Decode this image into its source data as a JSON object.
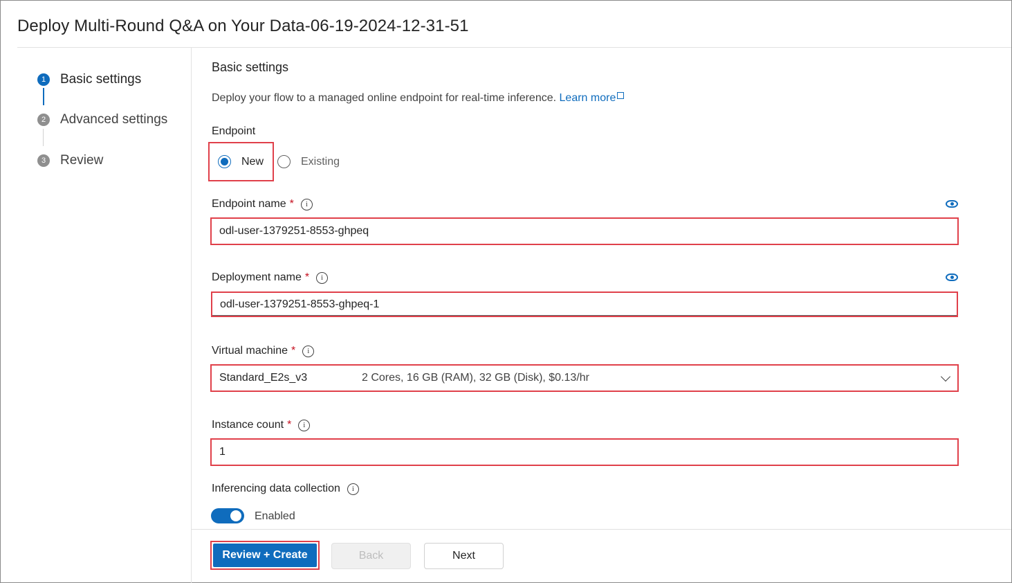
{
  "header": {
    "title": "Deploy Multi-Round Q&A on Your Data-06-19-2024-12-31-51"
  },
  "steps": [
    {
      "number": "1",
      "label": "Basic settings",
      "state": "active"
    },
    {
      "number": "2",
      "label": "Advanced settings",
      "state": "inactive"
    },
    {
      "number": "3",
      "label": "Review",
      "state": "inactive"
    }
  ],
  "main": {
    "heading": "Basic settings",
    "description": "Deploy your flow to a managed online endpoint for real-time inference.",
    "learn_more": "Learn more",
    "endpoint": {
      "label": "Endpoint",
      "options": [
        "New",
        "Existing"
      ],
      "selected": "New"
    },
    "endpoint_name": {
      "label": "Endpoint name",
      "required": "*",
      "value": "odl-user-1379251-8553-ghpeq"
    },
    "deployment_name": {
      "label": "Deployment name",
      "required": "*",
      "value": "odl-user-1379251-8553-ghpeq-1"
    },
    "virtual_machine": {
      "label": "Virtual machine",
      "required": "*",
      "value": "Standard_E2s_v3",
      "spec": "2 Cores, 16 GB (RAM), 32 GB (Disk), $0.13/hr"
    },
    "instance_count": {
      "label": "Instance count",
      "required": "*",
      "value": "1"
    },
    "data_collection": {
      "label": "Inferencing data collection",
      "toggle_label": "Enabled",
      "enabled": true
    }
  },
  "footer": {
    "review_create": "Review + Create",
    "back": "Back",
    "next": "Next"
  },
  "colors": {
    "accent": "#0f6cbd",
    "highlight": "#e0404a",
    "required": "#c50f1f"
  }
}
